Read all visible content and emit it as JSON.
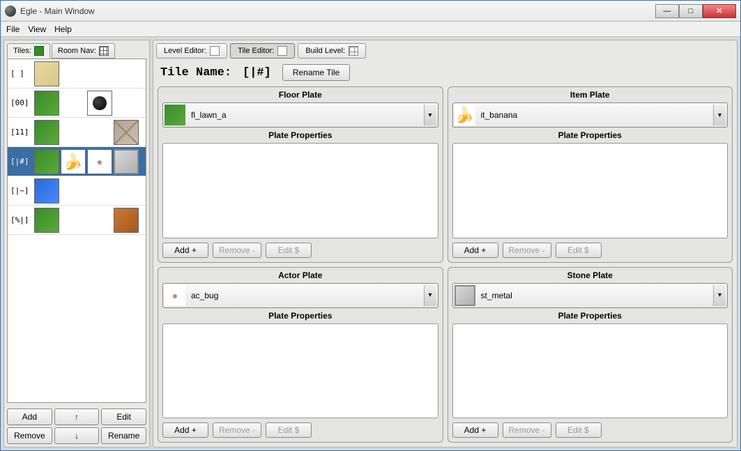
{
  "window": {
    "title": "Egle - Main Window"
  },
  "menu": {
    "file": "File",
    "view": "View",
    "help": "Help"
  },
  "leftTabs": {
    "tiles": "Tiles:",
    "roomNav": "Room Nav:"
  },
  "tileList": [
    {
      "code": "[  ]"
    },
    {
      "code": "[00]"
    },
    {
      "code": "[11]"
    },
    {
      "code": "[|#]"
    },
    {
      "code": "[|~]"
    },
    {
      "code": "[%|]"
    }
  ],
  "leftButtons": {
    "add": "Add",
    "up": "↑",
    "edit": "Edit",
    "remove": "Remove",
    "down": "↓",
    "rename": "Rename"
  },
  "editorTabs": {
    "level": "Level Editor:",
    "tile": "Tile Editor:",
    "build": "Build Level:"
  },
  "tileName": {
    "label": "Tile Name:",
    "value": "[|#]",
    "rename": "Rename Tile"
  },
  "plates": {
    "floor": {
      "title": "Floor Plate",
      "value": "fl_lawn_a",
      "props": "Plate Properties"
    },
    "item": {
      "title": "Item Plate",
      "value": "it_banana",
      "props": "Plate Properties"
    },
    "actor": {
      "title": "Actor Plate",
      "value": "ac_bug",
      "props": "Plate Properties"
    },
    "stone": {
      "title": "Stone Plate",
      "value": "st_metal",
      "props": "Plate Properties"
    }
  },
  "plateButtons": {
    "add": "Add +",
    "remove": "Remove -",
    "edit": "Edit $"
  }
}
